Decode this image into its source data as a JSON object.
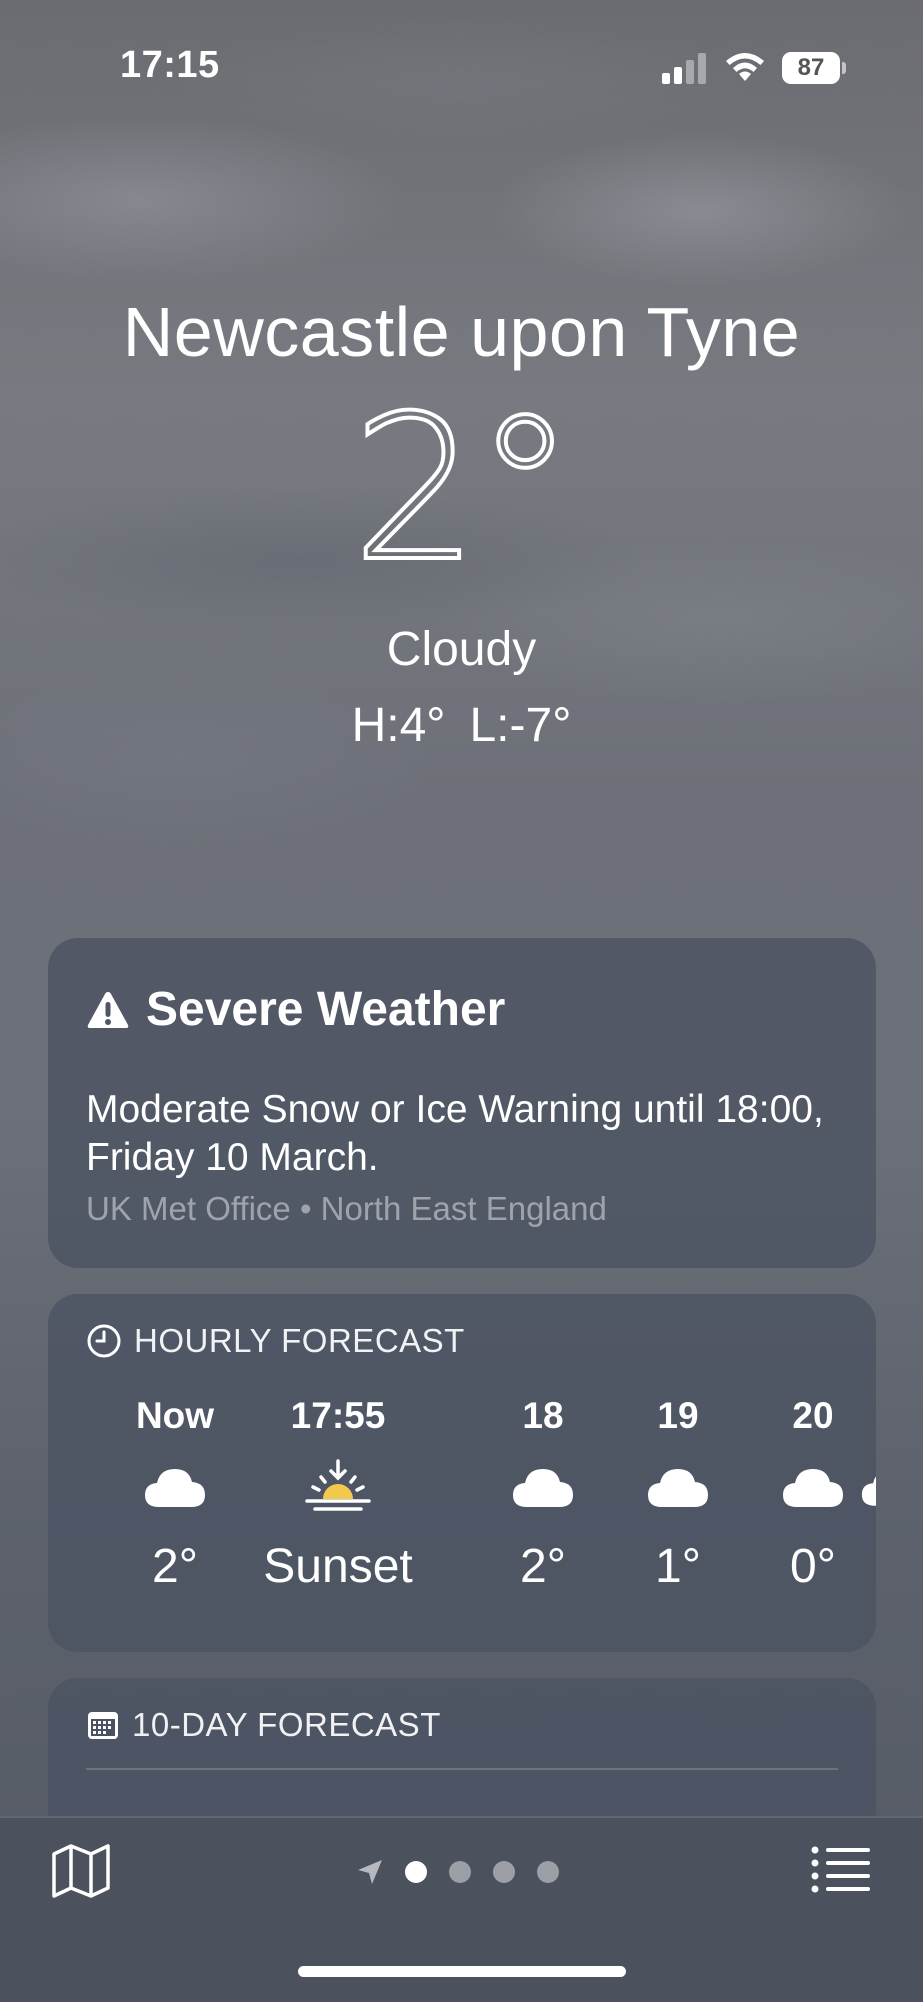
{
  "status_bar": {
    "time": "17:15",
    "battery": "87",
    "signal_icon": "cellular-signal-icon",
    "wifi_icon": "wifi-icon"
  },
  "location": {
    "city": "Newcastle upon Tyne",
    "temperature": "2°",
    "condition": "Cloudy",
    "high": "H:4°",
    "low": "L:-7°"
  },
  "severe_weather": {
    "icon": "warning-triangle-icon",
    "title": "Severe Weather",
    "message": "Moderate Snow or Ice Warning until 18:00, Friday 10 March.",
    "source": "UK Met Office • North East England"
  },
  "hourly_forecast": {
    "icon": "clock-icon",
    "title": "HOURLY FORECAST",
    "hours": [
      {
        "label": "Now",
        "icon": "cloud-icon",
        "value": "2°"
      },
      {
        "label": "17:55",
        "icon": "sunset-icon",
        "value": "Sunset"
      },
      {
        "label": "18",
        "icon": "cloud-icon",
        "value": "2°"
      },
      {
        "label": "19",
        "icon": "cloud-icon",
        "value": "1°"
      },
      {
        "label": "20",
        "icon": "cloud-icon",
        "value": "0°"
      }
    ]
  },
  "ten_day_forecast": {
    "icon": "calendar-icon",
    "title": "10-DAY FORECAST"
  },
  "toolbar": {
    "map_icon": "map-icon",
    "location_icon": "location-arrow-icon",
    "pages": 4,
    "active_page": 1,
    "list_icon": "list-icon"
  },
  "colors": {
    "card_bg": "#4a5261",
    "toolbar_bg": "#4b525d",
    "text": "#ffffff",
    "muted_text": "#a0a5ad"
  }
}
